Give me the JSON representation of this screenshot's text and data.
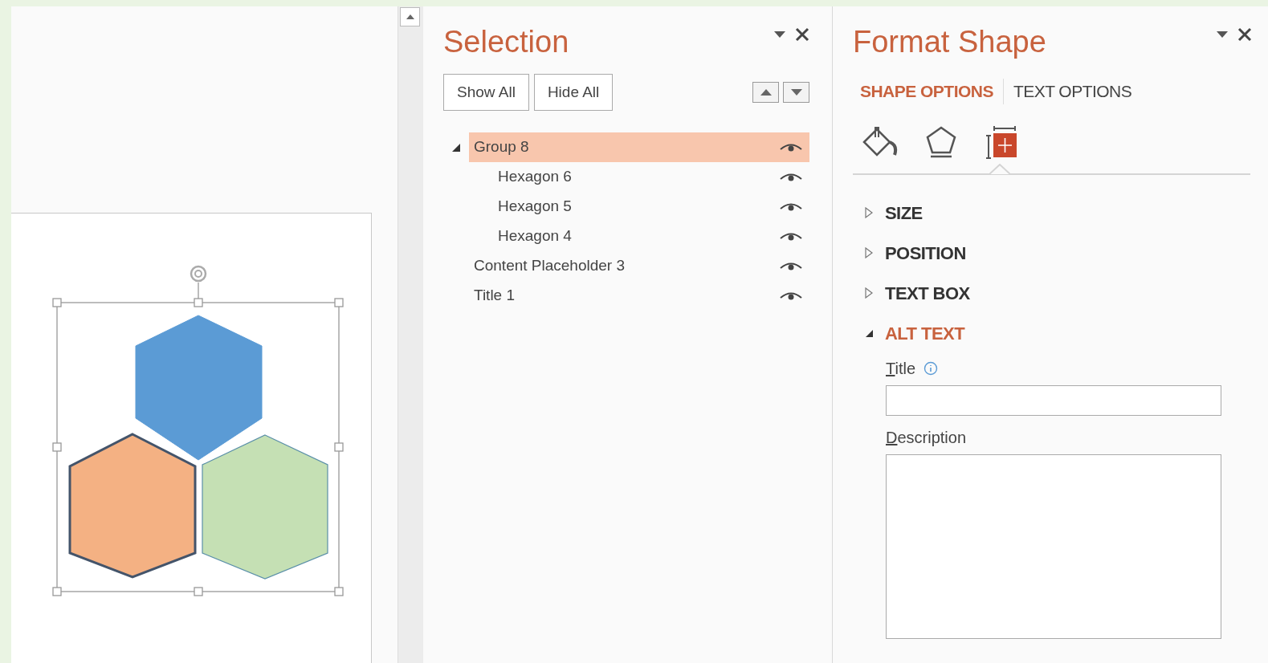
{
  "canvas": {
    "shapes": [
      {
        "kind": "hexagon",
        "color": "#5b9bd5"
      },
      {
        "kind": "hexagon",
        "color": "#f4b183"
      },
      {
        "kind": "hexagon",
        "color": "#c5e0b4"
      }
    ],
    "selected": true
  },
  "selection_pane": {
    "title": "Selection",
    "buttons": [
      "Show All",
      "Hide All"
    ],
    "items": [
      {
        "name": "Group 8",
        "selected": true,
        "expanded": true,
        "visible": true,
        "children": [
          {
            "name": "Hexagon 6",
            "selected": false,
            "visible": true
          },
          {
            "name": "Hexagon 5",
            "selected": false,
            "visible": true
          },
          {
            "name": "Hexagon 4",
            "selected": false,
            "visible": true
          }
        ]
      },
      {
        "name": "Content Placeholder 3",
        "selected": false,
        "visible": true
      },
      {
        "name": "Title 1",
        "selected": false,
        "visible": true
      }
    ]
  },
  "format_pane": {
    "title": "Format Shape",
    "tabs": [
      {
        "label": "SHAPE OPTIONS",
        "selected": true
      },
      {
        "label": "TEXT OPTIONS",
        "selected": false
      }
    ],
    "icon_tabs": [
      {
        "kind": "fill",
        "selected": false
      },
      {
        "kind": "effects",
        "selected": false
      },
      {
        "kind": "size",
        "selected": true
      }
    ],
    "sections": [
      {
        "label": "SIZE",
        "expanded": false
      },
      {
        "label": "POSITION",
        "expanded": false
      },
      {
        "label": "TEXT BOX",
        "expanded": false
      },
      {
        "label": "ALT TEXT",
        "expanded": true
      }
    ],
    "fields": [
      {
        "label": "Title",
        "kind": "line",
        "info": true
      },
      {
        "label": "Description",
        "kind": "area"
      }
    ]
  }
}
